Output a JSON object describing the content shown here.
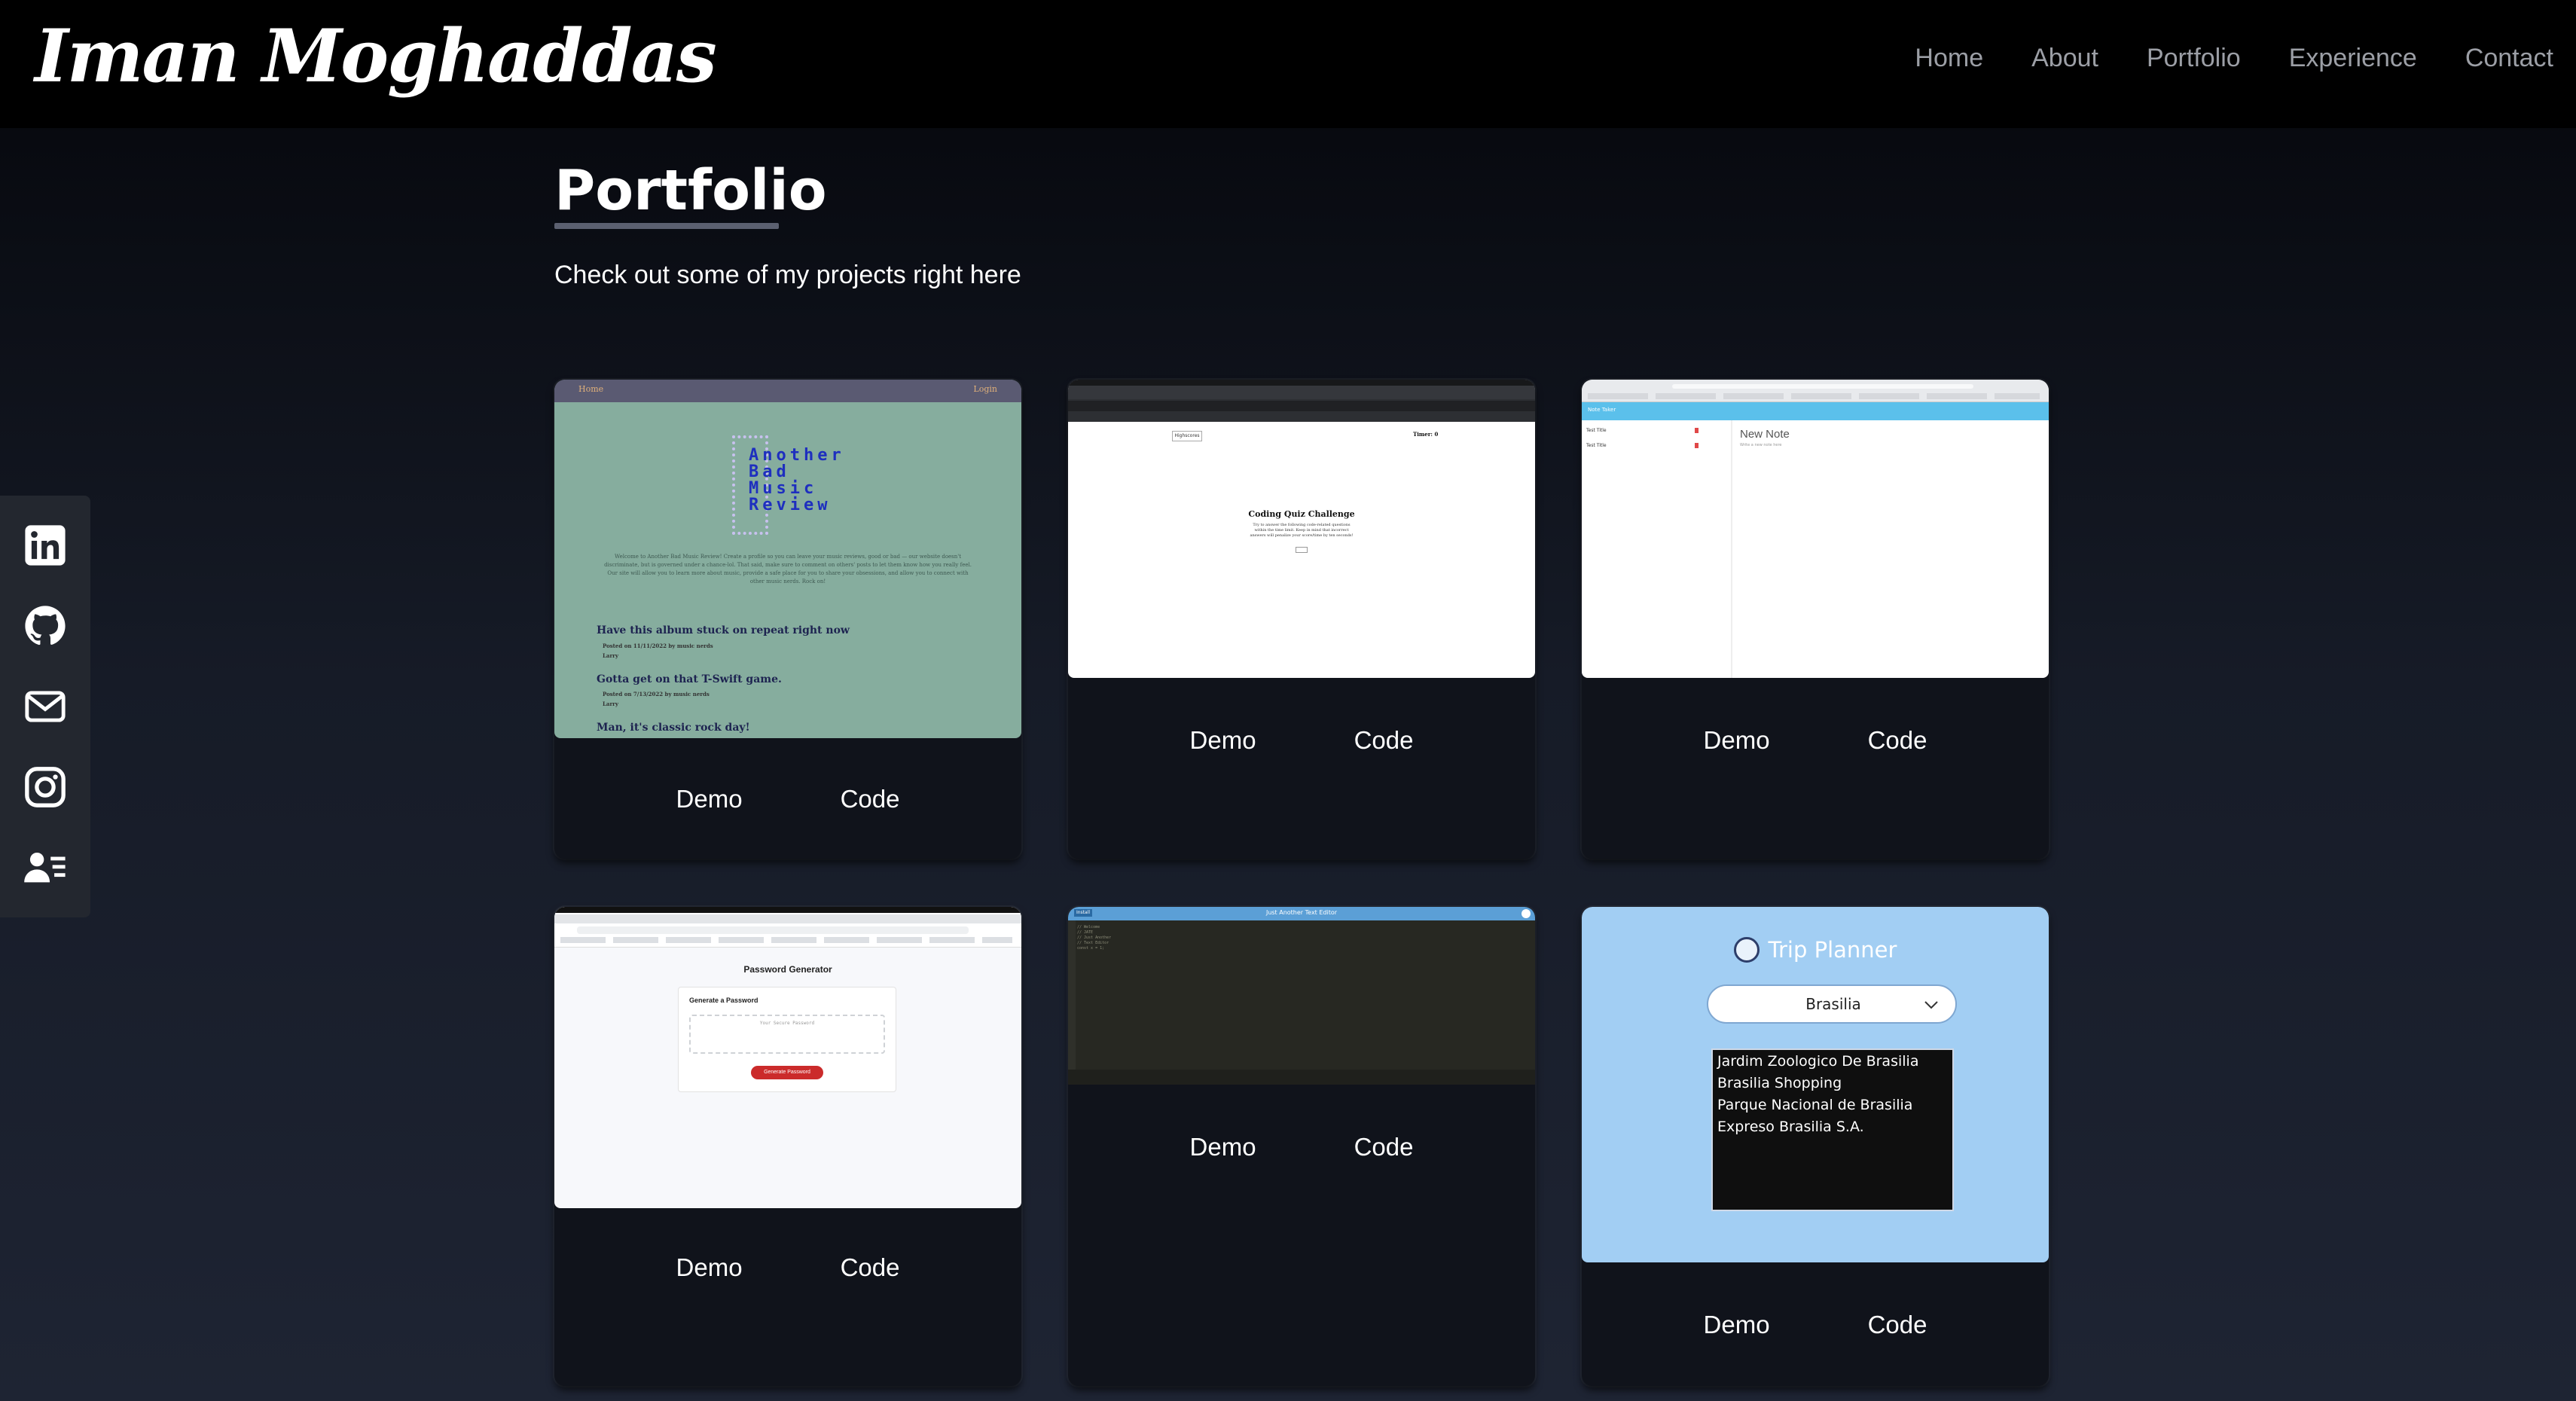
{
  "header": {
    "logo": "Iman Moghaddas",
    "nav": [
      "Home",
      "About",
      "Portfolio",
      "Experience",
      "Contact"
    ]
  },
  "sidebar": {
    "icons": [
      "linkedin-icon",
      "github-icon",
      "email-icon",
      "instagram-icon",
      "resume-icon"
    ]
  },
  "main": {
    "title": "Portfolio",
    "subtitle": "Check out some of my projects right here"
  },
  "cards": [
    {
      "demo": "Demo",
      "code": "Code",
      "thumb": {
        "nav_left": "Home",
        "nav_right": "Login",
        "logo_text": "Another\nBad\nMusic\nReview",
        "intro": "Welcome to Another Bad Music Review! Create a profile so you can leave your music reviews, good or bad — our website doesn't discriminate, but is governed under a chance-lol. That said, make sure to comment on others' posts to let them know how you really feel. Our site will allow you to learn more about music, provide a safe place for you to share your obsessions, and allow you to connect with other music nerds. Rock on!",
        "posts": [
          {
            "title": "Have this album stuck on repeat right now",
            "meta": "Posted on 11/11/2022 by music nerds",
            "author": "Larry"
          },
          {
            "title": "Gotta get on that T-Swift game.",
            "meta": "Posted on 7/13/2022 by music nerds",
            "author": "Larry"
          },
          {
            "title": "Man, it's classic rock day!",
            "meta": "",
            "author": ""
          }
        ]
      }
    },
    {
      "demo": "Demo",
      "code": "Code",
      "thumb": {
        "highscores": "Highscores",
        "timer": "Timer: 0",
        "heading": "Coding Quiz Challenge",
        "text": "Try to answer the following code-related questions within the time limit. Keep in mind that incorrect answers will penalize your score/time by ten seconds!",
        "start": "Start"
      }
    },
    {
      "demo": "Demo",
      "code": "Code",
      "thumb": {
        "app": "Note Taker",
        "notes": [
          "Test Title",
          "Test Title"
        ],
        "new_note": "New Note",
        "placeholder": "Write a new note here"
      }
    },
    {
      "demo": "Demo",
      "code": "Code",
      "thumb": {
        "heading": "Password Generator",
        "card_title": "Generate a Password",
        "placeholder": "Your Secure Password",
        "button": "Generate Password"
      }
    },
    {
      "demo": "Demo",
      "code": "Code",
      "thumb": {
        "title": "Just Another Text Editor",
        "install": "Install",
        "code": "// Welcome\n// JATE\n// Just Another\n// Text Editor\nconst x = 1;"
      }
    },
    {
      "demo": "Demo",
      "code": "Code",
      "thumb": {
        "title": "Trip Planner",
        "selected_city": "Brasilia",
        "results": [
          "Jardim Zoologico De Brasilia",
          "Brasilia Shopping",
          "Parque Nacional de Brasilia",
          "Expreso Brasilia S.A."
        ]
      }
    }
  ],
  "colors": {
    "background_top": "#000000",
    "background_bottom": "#1e2433",
    "card": "#10131b",
    "nav_text": "#9c9fa6",
    "sidebar": "#23272f"
  }
}
